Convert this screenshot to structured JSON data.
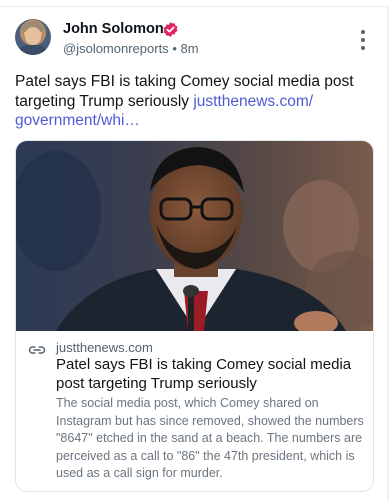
{
  "author": {
    "name": "John Solomon",
    "handle": "@jsolomonreports",
    "separator": "•",
    "time": "8m"
  },
  "post": {
    "text": "Patel says FBI is taking Comey social media post targeting Trump seriously ",
    "link_text": "justthenews.com/\ngovernment/whi…"
  },
  "card": {
    "domain": "justthenews.com",
    "title": "Patel says FBI is taking Comey social media post targeting Trump seriously",
    "description": "The social media post, which Comey shared on Instagram but has since removed, showed the numbers \"8647\" etched in the sand at a beach. The numbers are perceived as a call to \"86\" the 47th president, which is used as a call sign for murder."
  },
  "colors": {
    "link": "#4f5bd5",
    "verified": "#e0245e",
    "muted_text": "#536471"
  },
  "icons": {
    "verified": "verified-badge-icon",
    "more": "more-options-icon",
    "link": "link-icon"
  }
}
